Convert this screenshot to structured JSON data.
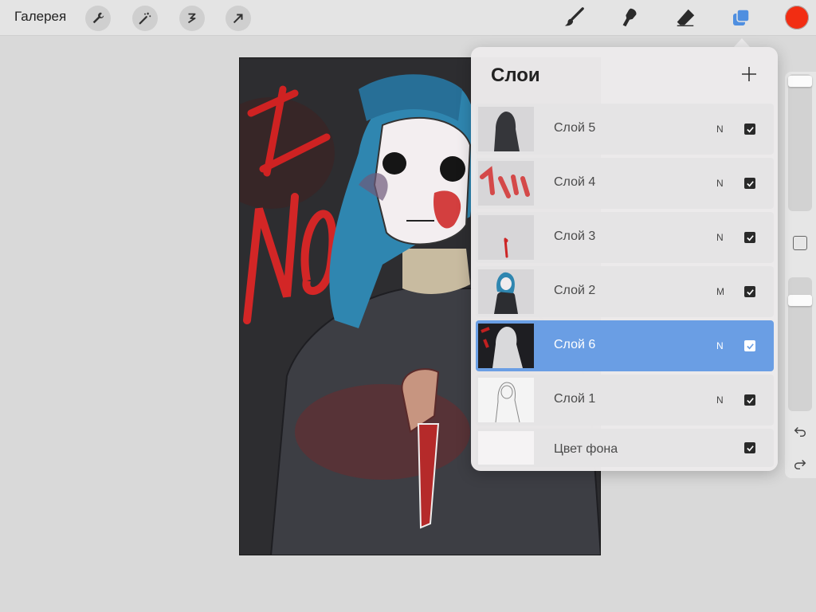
{
  "toolbar": {
    "gallery_label": "Галерея",
    "left_tools": [
      "wrench-icon",
      "magic-wand-icon",
      "selection-icon",
      "transform-arrow-icon"
    ],
    "right_tools": [
      "brush-icon",
      "smudge-icon",
      "eraser-icon",
      "layers-icon"
    ],
    "active_color": "#f22d12"
  },
  "layers_panel": {
    "title": "Слои",
    "add_icon": "plus-icon",
    "selected_color": "#6a9ee4",
    "layers": [
      {
        "name": "Слой 5",
        "blend": "N",
        "visible": true
      },
      {
        "name": "Слой 4",
        "blend": "N",
        "visible": true
      },
      {
        "name": "Слой 3",
        "blend": "N",
        "visible": true
      },
      {
        "name": "Слой 2",
        "blend": "M",
        "visible": true
      },
      {
        "name": "Слой 6",
        "blend": "N",
        "visible": true,
        "selected": true
      },
      {
        "name": "Слой 1",
        "blend": "N",
        "visible": true
      }
    ],
    "background": {
      "name": "Цвет фона",
      "visible": true
    }
  },
  "sidebar": {
    "undo_icon": "undo-icon",
    "redo_icon": "redo-icon"
  }
}
